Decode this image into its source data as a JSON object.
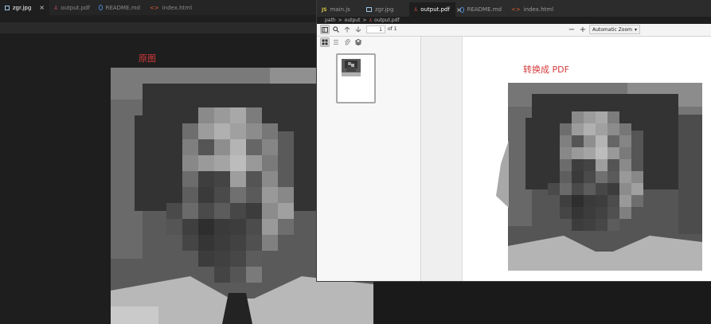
{
  "back_window": {
    "tabs": [
      {
        "label": "zgr.jpg",
        "icon": "image-icon",
        "active": true
      },
      {
        "label": "output.pdf",
        "icon": "pdf-icon",
        "active": false
      },
      {
        "label": "README.md",
        "icon": "info-icon",
        "active": false
      },
      {
        "label": "index.html",
        "icon": "html-icon",
        "active": false
      }
    ],
    "close_glyph": "×",
    "original_caption": "原图"
  },
  "front_window": {
    "tabs": [
      {
        "label": "main.js",
        "icon": "js-icon",
        "active": false
      },
      {
        "label": "zgr.jpg",
        "icon": "image-icon",
        "active": false
      },
      {
        "label": "output.pdf",
        "icon": "pdf-icon",
        "active": true
      },
      {
        "label": "README.md",
        "icon": "info-icon",
        "active": false
      },
      {
        "label": "index.html",
        "icon": "html-icon",
        "active": false
      }
    ],
    "close_glyph": "×",
    "breadcrumb": [
      "path",
      "output",
      "output.pdf"
    ],
    "breadcrumb_sep": ">",
    "pdf_toolbar": {
      "page_number": "1",
      "page_of": "of 1",
      "zoom_out": "−",
      "zoom_in": "+",
      "zoom_level": "Automatic Zoom"
    },
    "pdf_caption": "转换成 PDF"
  },
  "colors": {
    "caption_red": "#d43a3a",
    "editor_bg": "#1e1e1e",
    "tabbar_bg": "#252526"
  }
}
